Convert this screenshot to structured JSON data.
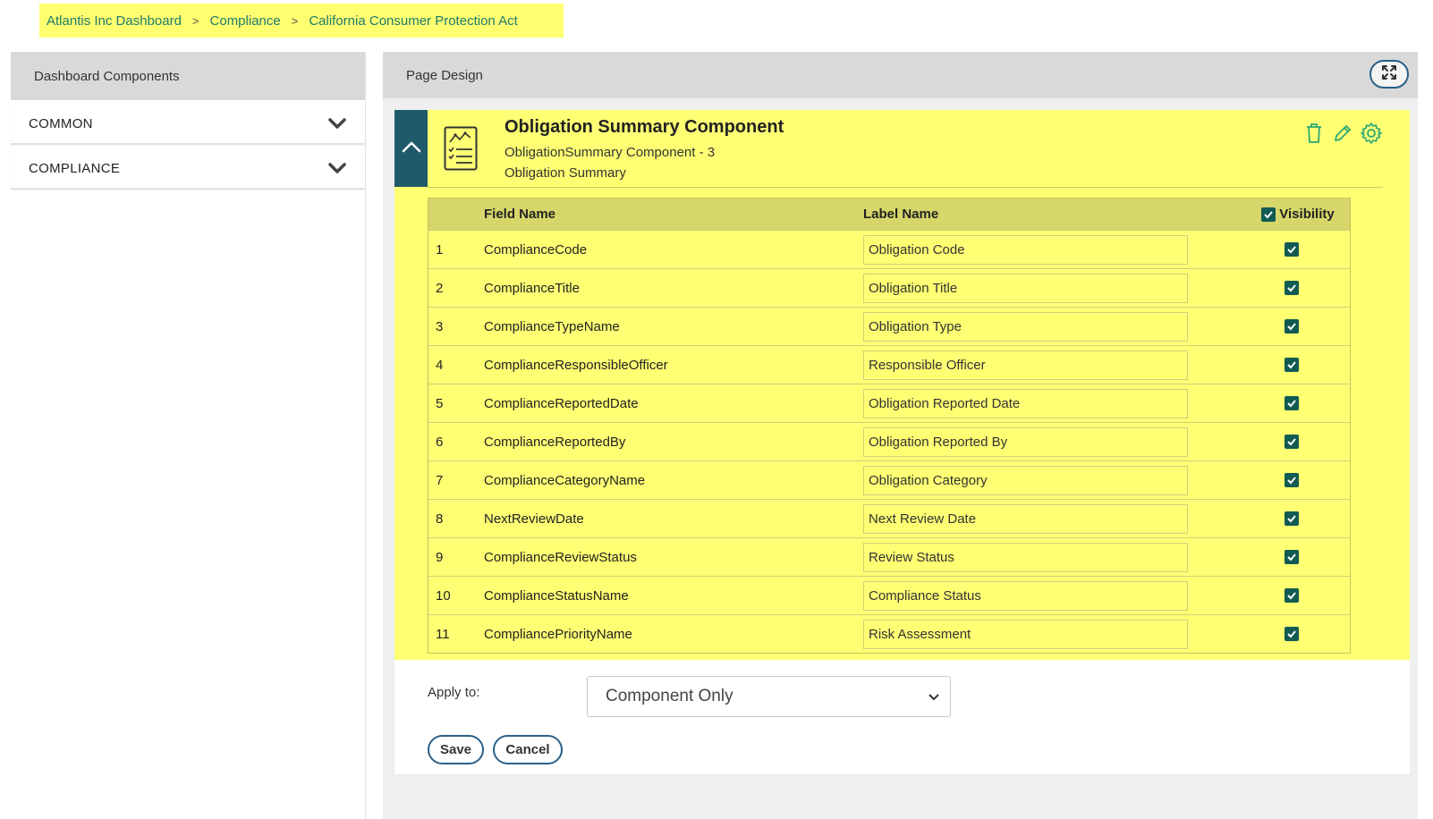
{
  "breadcrumb": {
    "items": [
      "Atlantis Inc Dashboard",
      "Compliance",
      "California Consumer Protection Act"
    ],
    "separator": ">"
  },
  "sidebar": {
    "title": "Dashboard Components",
    "items": [
      {
        "label": "COMMON",
        "icon": "chevron-down-icon"
      },
      {
        "label": "COMPLIANCE",
        "icon": "chevron-down-icon"
      }
    ]
  },
  "main": {
    "title": "Page Design",
    "expand_icon": "expand-icon"
  },
  "component": {
    "title": "Obligation Summary Component",
    "subtitle": "ObligationSummary Component - 3",
    "description": "Obligation Summary",
    "tools": [
      "trash-icon",
      "pencil-icon",
      "gear-icon"
    ],
    "accent_color": "#ffff74",
    "tab_color": "#1f5a6a"
  },
  "grid": {
    "headers": {
      "field": "Field Name",
      "label": "Label Name",
      "visibility": "Visibility"
    },
    "visibility_all": true,
    "rows": [
      {
        "num": "1",
        "field": "ComplianceCode",
        "label": "Obligation Code",
        "visible": true
      },
      {
        "num": "2",
        "field": "ComplianceTitle",
        "label": "Obligation Title",
        "visible": true
      },
      {
        "num": "3",
        "field": "ComplianceTypeName",
        "label": "Obligation Type",
        "visible": true
      },
      {
        "num": "4",
        "field": "ComplianceResponsibleOfficer",
        "label": "Responsible Officer",
        "visible": true
      },
      {
        "num": "5",
        "field": "ComplianceReportedDate",
        "label": "Obligation Reported Date",
        "visible": true
      },
      {
        "num": "6",
        "field": "ComplianceReportedBy",
        "label": "Obligation Reported By",
        "visible": true
      },
      {
        "num": "7",
        "field": "ComplianceCategoryName",
        "label": "Obligation Category",
        "visible": true
      },
      {
        "num": "8",
        "field": "NextReviewDate",
        "label": "Next Review Date",
        "visible": true
      },
      {
        "num": "9",
        "field": "ComplianceReviewStatus",
        "label": "Review Status",
        "visible": true
      },
      {
        "num": "10",
        "field": "ComplianceStatusName",
        "label": "Compliance Status",
        "visible": true
      },
      {
        "num": "11",
        "field": "CompliancePriorityName",
        "label": "Risk Assessment",
        "visible": true
      }
    ]
  },
  "footer": {
    "apply_label": "Apply to:",
    "apply_value": "Component Only",
    "save_label": "Save",
    "cancel_label": "Cancel"
  }
}
